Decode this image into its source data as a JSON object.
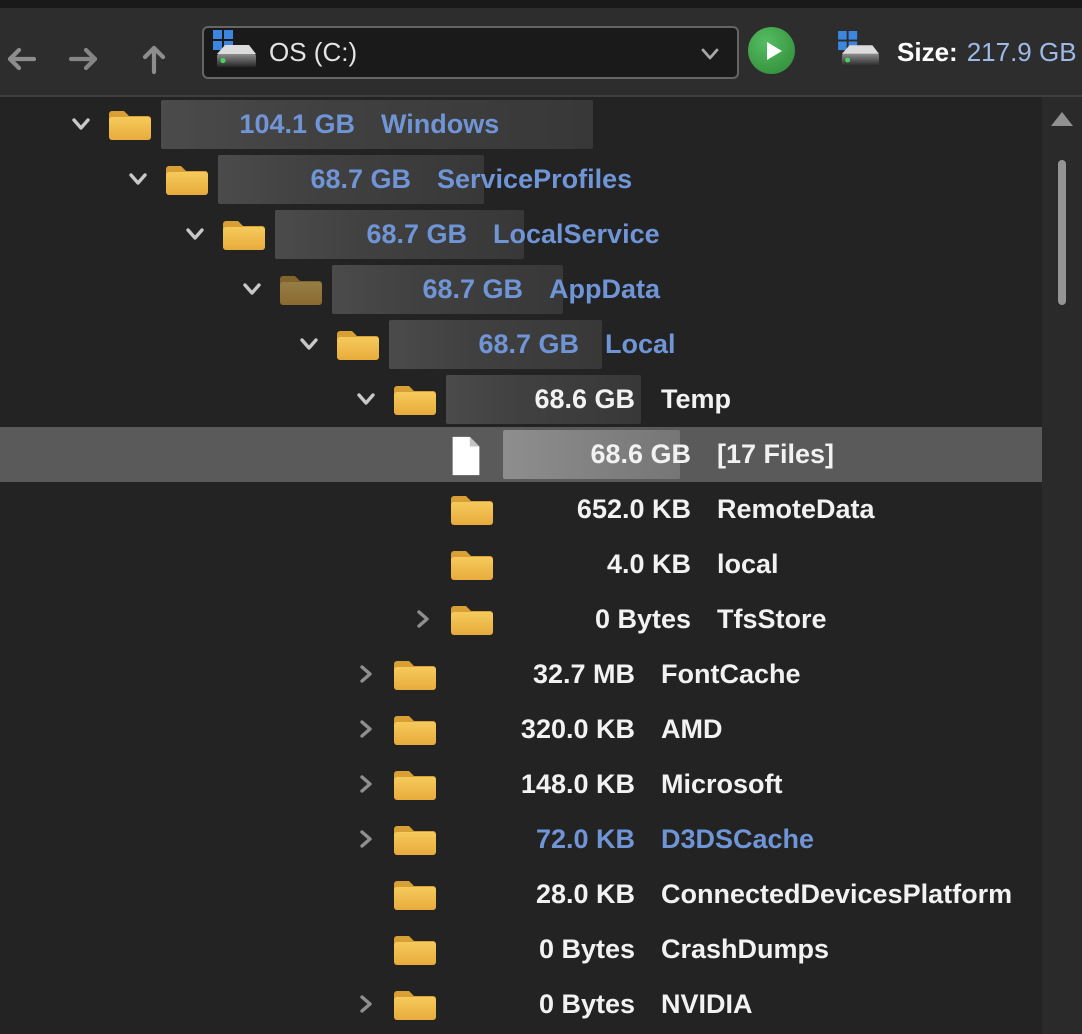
{
  "toolbar": {
    "back_button": "back",
    "forward_button": "forward",
    "up_button": "up",
    "drive_selector_value": "OS (C:)",
    "scan_button": "start-scan",
    "size_label": "Size:",
    "size_value": "217.9 GB"
  },
  "colors": {
    "compressed_text_blue": "#7095d6",
    "normal_text": "#f2f2f2",
    "usage_bar": "#3f3f3f",
    "selected_row": "#5a5a5a",
    "scan_button_green": "#3da84a",
    "folder_gold": "#f0bd4a"
  },
  "tree": {
    "rows": [
      {
        "name": "Windows",
        "size": "104.1 GB",
        "depth": 0,
        "expand": "expanded",
        "icon": "folder",
        "compressed": true,
        "dimmed": false,
        "selected": false,
        "pct": 0.478
      },
      {
        "name": "ServiceProfiles",
        "size": "68.7 GB",
        "depth": 1,
        "expand": "expanded",
        "icon": "folder",
        "compressed": true,
        "dimmed": false,
        "selected": false,
        "pct": 0.315
      },
      {
        "name": "LocalService",
        "size": "68.7 GB",
        "depth": 2,
        "expand": "expanded",
        "icon": "folder",
        "compressed": true,
        "dimmed": false,
        "selected": false,
        "pct": 0.315
      },
      {
        "name": "AppData",
        "size": "68.7 GB",
        "depth": 3,
        "expand": "expanded",
        "icon": "folder",
        "compressed": true,
        "dimmed": true,
        "selected": false,
        "pct": 0.315
      },
      {
        "name": "Local",
        "size": "68.7 GB",
        "depth": 4,
        "expand": "expanded",
        "icon": "folder",
        "compressed": true,
        "dimmed": false,
        "selected": false,
        "pct": 0.315
      },
      {
        "name": "Temp",
        "size": "68.6 GB",
        "depth": 5,
        "expand": "expanded",
        "icon": "folder",
        "compressed": false,
        "dimmed": false,
        "selected": false,
        "pct": 0.3148
      },
      {
        "name": "[17 Files]",
        "size": "68.6 GB",
        "depth": 6,
        "expand": "none",
        "icon": "file",
        "compressed": false,
        "dimmed": false,
        "selected": true,
        "pct": 0.3148
      },
      {
        "name": "RemoteData",
        "size": "652.0 KB",
        "depth": 6,
        "expand": "none",
        "icon": "folder",
        "compressed": false,
        "dimmed": false,
        "selected": false,
        "pct": 0
      },
      {
        "name": "local",
        "size": "4.0 KB",
        "depth": 6,
        "expand": "none",
        "icon": "folder",
        "compressed": false,
        "dimmed": false,
        "selected": false,
        "pct": 0
      },
      {
        "name": "TfsStore",
        "size": "0 Bytes",
        "depth": 6,
        "expand": "collapsed",
        "icon": "folder",
        "compressed": false,
        "dimmed": false,
        "selected": false,
        "pct": 0
      },
      {
        "name": "FontCache",
        "size": "32.7 MB",
        "depth": 5,
        "expand": "collapsed",
        "icon": "folder",
        "compressed": false,
        "dimmed": false,
        "selected": false,
        "pct": 0
      },
      {
        "name": "AMD",
        "size": "320.0 KB",
        "depth": 5,
        "expand": "collapsed",
        "icon": "folder",
        "compressed": false,
        "dimmed": false,
        "selected": false,
        "pct": 0
      },
      {
        "name": "Microsoft",
        "size": "148.0 KB",
        "depth": 5,
        "expand": "collapsed",
        "icon": "folder",
        "compressed": false,
        "dimmed": false,
        "selected": false,
        "pct": 0
      },
      {
        "name": "D3DSCache",
        "size": "72.0 KB",
        "depth": 5,
        "expand": "collapsed",
        "icon": "folder",
        "compressed": true,
        "dimmed": false,
        "selected": false,
        "pct": 0
      },
      {
        "name": "ConnectedDevicesPlatform",
        "size": "28.0 KB",
        "depth": 5,
        "expand": "none",
        "icon": "folder",
        "compressed": false,
        "dimmed": false,
        "selected": false,
        "pct": 0
      },
      {
        "name": "CrashDumps",
        "size": "0 Bytes",
        "depth": 5,
        "expand": "none",
        "icon": "folder",
        "compressed": false,
        "dimmed": false,
        "selected": false,
        "pct": 0
      },
      {
        "name": "NVIDIA",
        "size": "0 Bytes",
        "depth": 5,
        "expand": "collapsed",
        "icon": "folder",
        "compressed": false,
        "dimmed": false,
        "selected": false,
        "pct": 0
      }
    ]
  }
}
